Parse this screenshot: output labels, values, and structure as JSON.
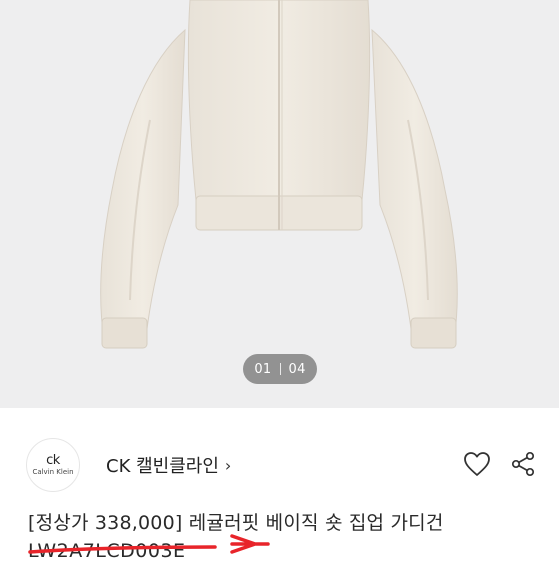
{
  "gallery": {
    "current_page": "01",
    "total_pages": "04"
  },
  "seller": {
    "logo_mark": "ck",
    "logo_name": "Calvin Klein",
    "brand_name": "CK 캘빈클라인",
    "chevron": "›"
  },
  "actions": {
    "like_icon": "heart-icon",
    "share_icon": "share-icon"
  },
  "product": {
    "title": "[정상가 338,000] 레귤러핏 베이직 숏 집업 가디건",
    "code": "LW2A7LCD003E"
  },
  "annotation": {
    "color": "#e8242a"
  }
}
